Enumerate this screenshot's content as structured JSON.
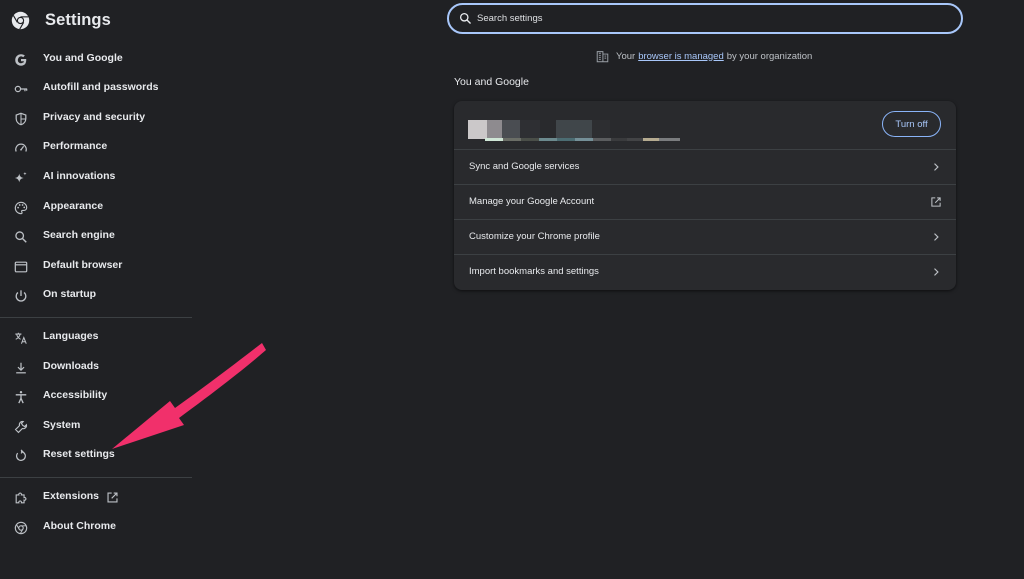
{
  "app": {
    "title": "Settings"
  },
  "sidebar": {
    "items": [
      {
        "label": "You and Google",
        "icon": "google-g-icon"
      },
      {
        "label": "Autofill and passwords",
        "icon": "key-icon"
      },
      {
        "label": "Privacy and security",
        "icon": "shield-icon"
      },
      {
        "label": "Performance",
        "icon": "speedometer-icon"
      },
      {
        "label": "AI innovations",
        "icon": "sparkle-icon"
      },
      {
        "label": "Appearance",
        "icon": "palette-icon"
      },
      {
        "label": "Search engine",
        "icon": "search-icon"
      },
      {
        "label": "Default browser",
        "icon": "browser-window-icon"
      },
      {
        "label": "On startup",
        "icon": "power-icon"
      },
      {
        "label": "Languages",
        "icon": "translate-icon"
      },
      {
        "label": "Downloads",
        "icon": "download-icon"
      },
      {
        "label": "Accessibility",
        "icon": "accessibility-icon"
      },
      {
        "label": "System",
        "icon": "wrench-icon"
      },
      {
        "label": "Reset settings",
        "icon": "reset-icon"
      },
      {
        "label": "Extensions",
        "icon": "puzzle-icon"
      },
      {
        "label": "About Chrome",
        "icon": "chrome-icon"
      }
    ]
  },
  "search": {
    "placeholder": "Search settings",
    "value": ""
  },
  "managed_notice": {
    "prefix": "Your",
    "link": "browser is managed",
    "suffix": "by your organization",
    "icon": "building-icon"
  },
  "main": {
    "section_title": "You and Google",
    "account": {
      "turn_off_label": "Turn off"
    },
    "rows": [
      {
        "label": "Sync and Google services",
        "icon": "chevron-right-icon"
      },
      {
        "label": "Manage your Google Account",
        "icon": "open-external-icon"
      },
      {
        "label": "Customize your Chrome profile",
        "icon": "chevron-right-icon"
      },
      {
        "label": "Import bookmarks and settings",
        "icon": "chevron-right-icon"
      }
    ]
  },
  "colors": {
    "background": "#202124",
    "card": "#292a2d",
    "text": "#e8eaed",
    "accent": "#a8c7fa",
    "annotation_arrow": "#f1306b"
  }
}
